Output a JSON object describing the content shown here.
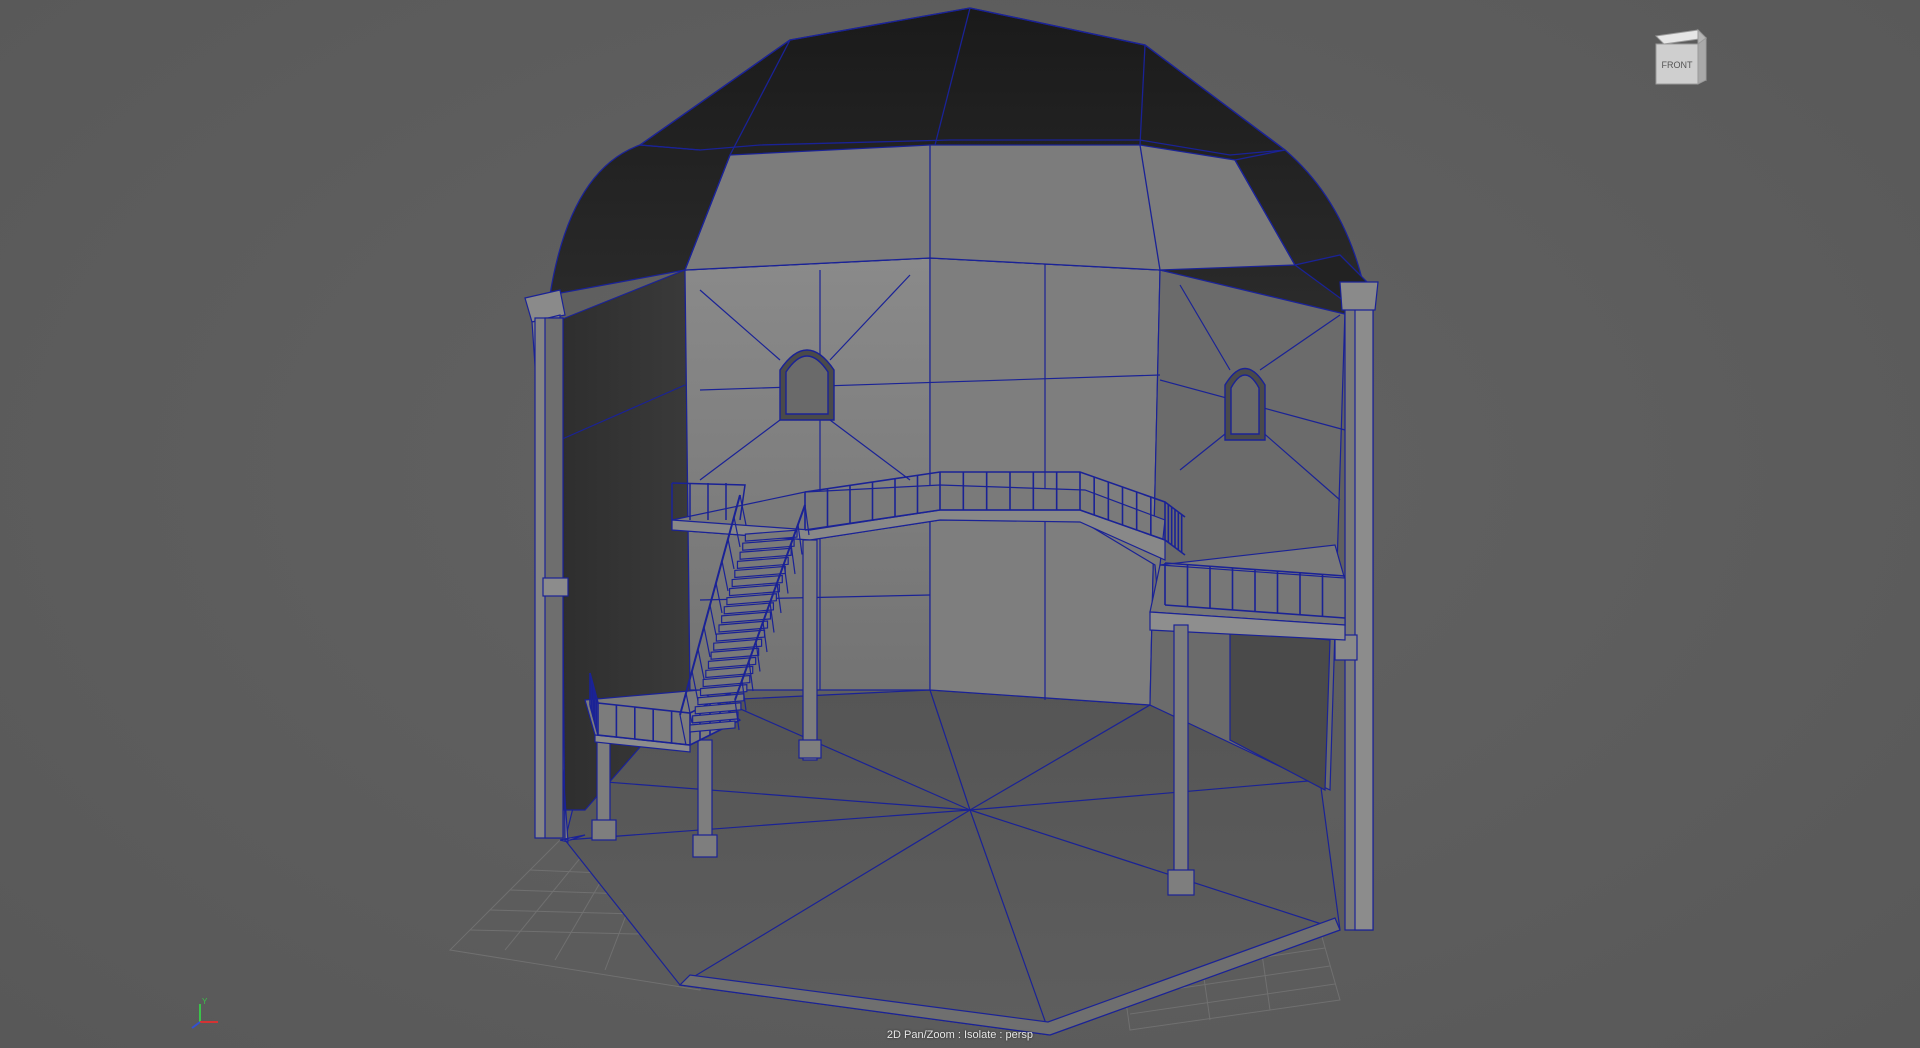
{
  "app": "3D modeling viewport",
  "viewport": {
    "camera_label": "2D Pan/Zoom : Isolate : persp",
    "viewcube_face": "FRONT",
    "background_color": "#5d5d5d",
    "wire_color": "#1a2296"
  },
  "axis_gizmo": {
    "y_label": "Y",
    "x_color": "#d43333",
    "y_color": "#3bc24a",
    "z_color": "#3350d4"
  },
  "scene": {
    "model": "domed tower interior with spiral balcony and staircase",
    "icons": [
      "viewcube-icon",
      "axis-gizmo-icon"
    ]
  }
}
